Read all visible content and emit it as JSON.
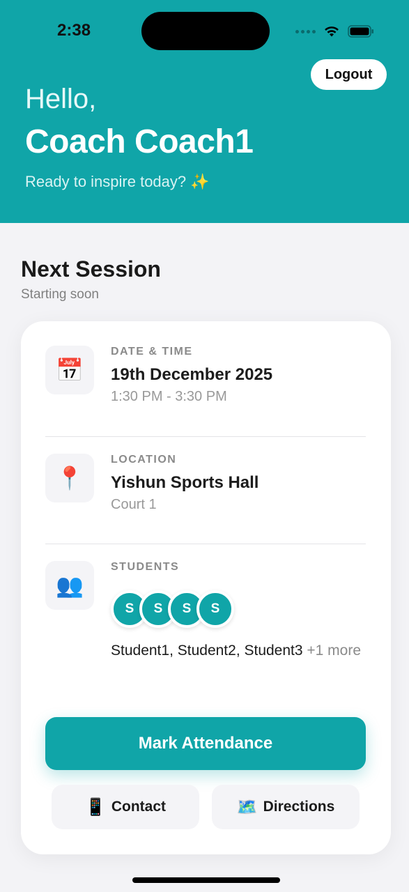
{
  "status_bar": {
    "time": "2:38"
  },
  "header": {
    "logout_label": "Logout",
    "greeting": "Hello,",
    "name": "Coach Coach1",
    "tagline": "Ready to inspire today? ✨",
    "background_color": "#10a5a8"
  },
  "section": {
    "title": "Next Session",
    "subtitle": "Starting soon"
  },
  "session": {
    "date_time": {
      "icon": "calendar-icon",
      "icon_glyph": "📅",
      "label": "DATE & TIME",
      "value": "19th December 2025",
      "sub": "1:30 PM - 3:30 PM"
    },
    "location": {
      "icon": "pin-icon",
      "icon_glyph": "📍",
      "label": "LOCATION",
      "value": "Yishun Sports Hall",
      "sub": "Court 1"
    },
    "students": {
      "icon": "people-icon",
      "icon_glyph": "👥",
      "label": "STUDENTS",
      "avatars": [
        "S",
        "S",
        "S",
        "S"
      ],
      "names": "Student1, Student2, Student3",
      "more": "+1 more"
    }
  },
  "actions": {
    "mark_attendance": "Mark Attendance",
    "contact": {
      "icon_glyph": "📱",
      "label": "Contact"
    },
    "directions": {
      "icon_glyph": "🗺️",
      "label": "Directions"
    }
  },
  "colors": {
    "accent": "#10a5a8"
  }
}
